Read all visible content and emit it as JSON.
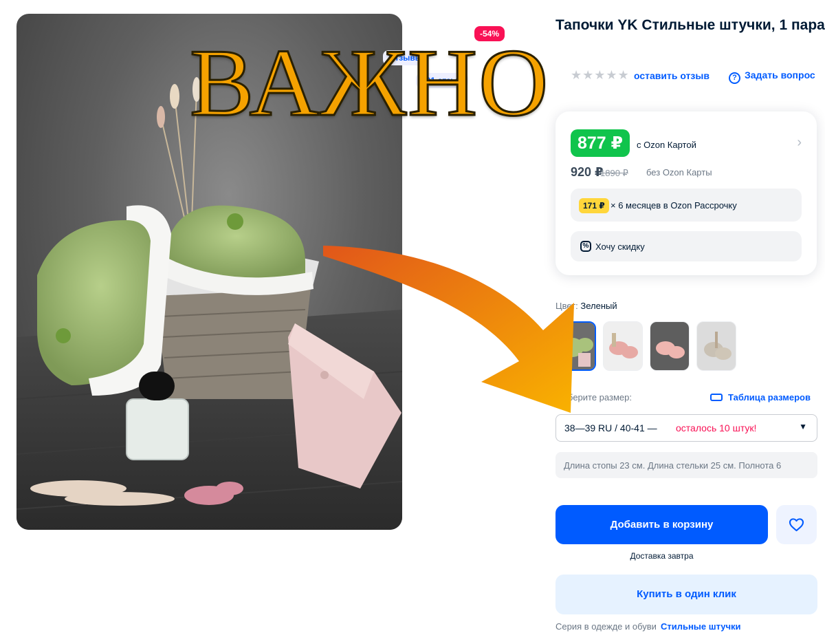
{
  "product": {
    "title": "Тапочки YK Стильные штучки, 1 пара",
    "discount_badge": "-54%",
    "chip_a": "Отзывы",
    "chip_b": "101 отзыв"
  },
  "reviews": {
    "stars": "★★★★★",
    "leave_review": "оставить отзыв",
    "ask_question": "Задать вопрос"
  },
  "price": {
    "main": "877 ₽",
    "main_note": "с Ozon Картой",
    "alt": "920 ₽",
    "old": "1890 ₽",
    "alt_note": "без Ozon Карты",
    "installment_amount": "171 ₽",
    "installment_text": "× 6 месяцев в Ozon Рассрочку",
    "want_discount": "Хочу скидку"
  },
  "color": {
    "label": "Цвет:",
    "value": "Зеленый"
  },
  "size": {
    "label": "Выберите размер:",
    "table_link": "Таблица размеров",
    "selected": "38—39 RU / 40-41 —",
    "stock": "осталось 10 штук!",
    "info": "Длина стопы 23 см. Длина стельки 25 см. Полнота 6"
  },
  "actions": {
    "add_to_cart": "Добавить в корзину",
    "delivery": "Доставка завтра",
    "buy_one_click": "Купить в один клик"
  },
  "series": {
    "label": "Серия в одежде и обуви",
    "link": "Стильные штучки"
  },
  "overlay": {
    "word": "ВАЖНО",
    "color": "#f5a200"
  },
  "colors": {
    "accent": "#005bff",
    "price_green": "#10c44c",
    "discount_red": "#f91155",
    "installment_yellow": "#ffd63b"
  }
}
